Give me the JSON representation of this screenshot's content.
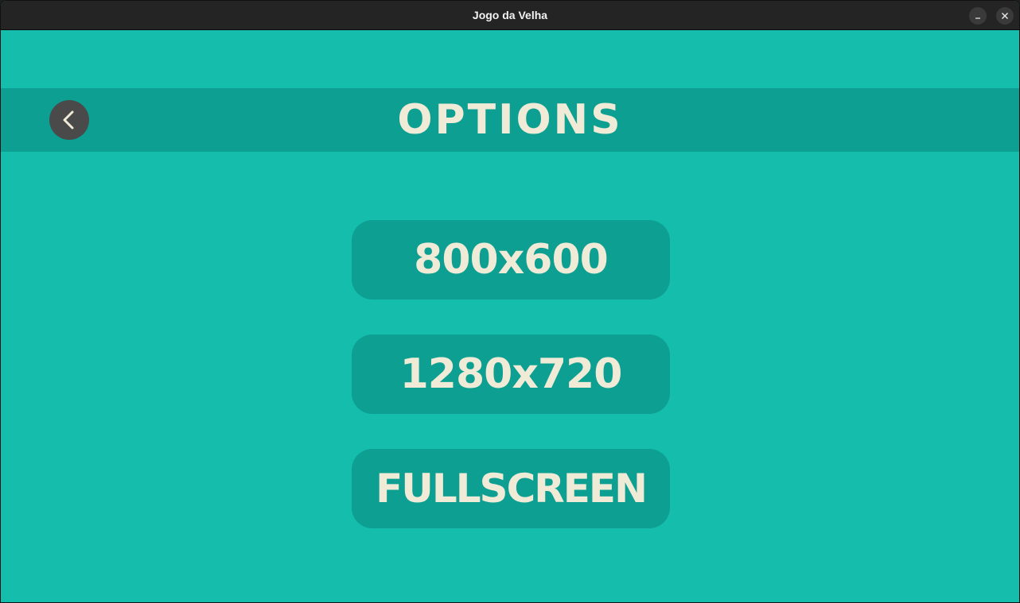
{
  "window": {
    "title": "Jogo da Velha",
    "controls": {
      "minimize": "–",
      "close": "✕"
    }
  },
  "header": {
    "title": "OPTIONS",
    "back_icon": "chevron-left-icon"
  },
  "resolutions": [
    {
      "label": "800x600"
    },
    {
      "label": "1280x720"
    },
    {
      "label": "FULLSCREEN"
    }
  ],
  "colors": {
    "background": "#14bdac",
    "band": "#0d9f91",
    "text": "#efebd6",
    "back_button": "#4a4a4a",
    "titlebar": "#242424"
  }
}
